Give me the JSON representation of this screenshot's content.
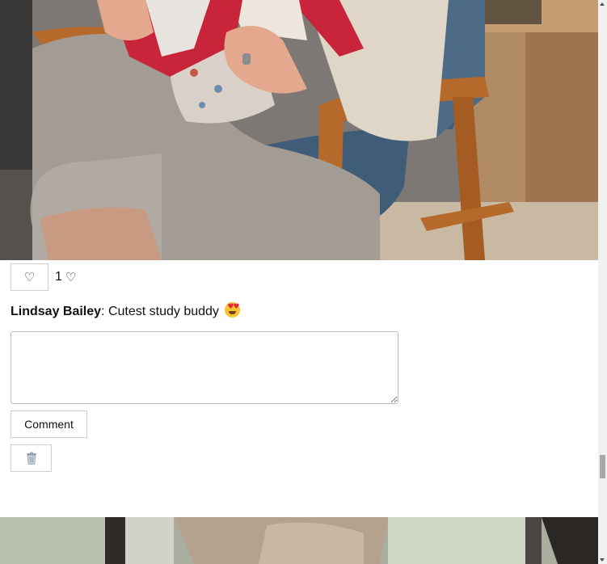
{
  "post": {
    "like_button_icon": "♡",
    "like_count": "1",
    "like_count_icon": "♡",
    "author": "Lindsay Bailey",
    "separator": ":",
    "caption": " Cutest study buddy ",
    "caption_emoji": "smiling-face-with-heart-eyes-icon",
    "comment_placeholder": "",
    "comment_button_label": "Comment",
    "delete_button_icon": "trash-can-icon"
  },
  "colors": {
    "emoji_face": "#f7c431",
    "emoji_heart": "#e2263a",
    "book_red": "#c8253a",
    "chair_wood": "#b5692a",
    "chair_cushion": "#3f5c78"
  },
  "scrollbar": {
    "position": 0.81
  }
}
